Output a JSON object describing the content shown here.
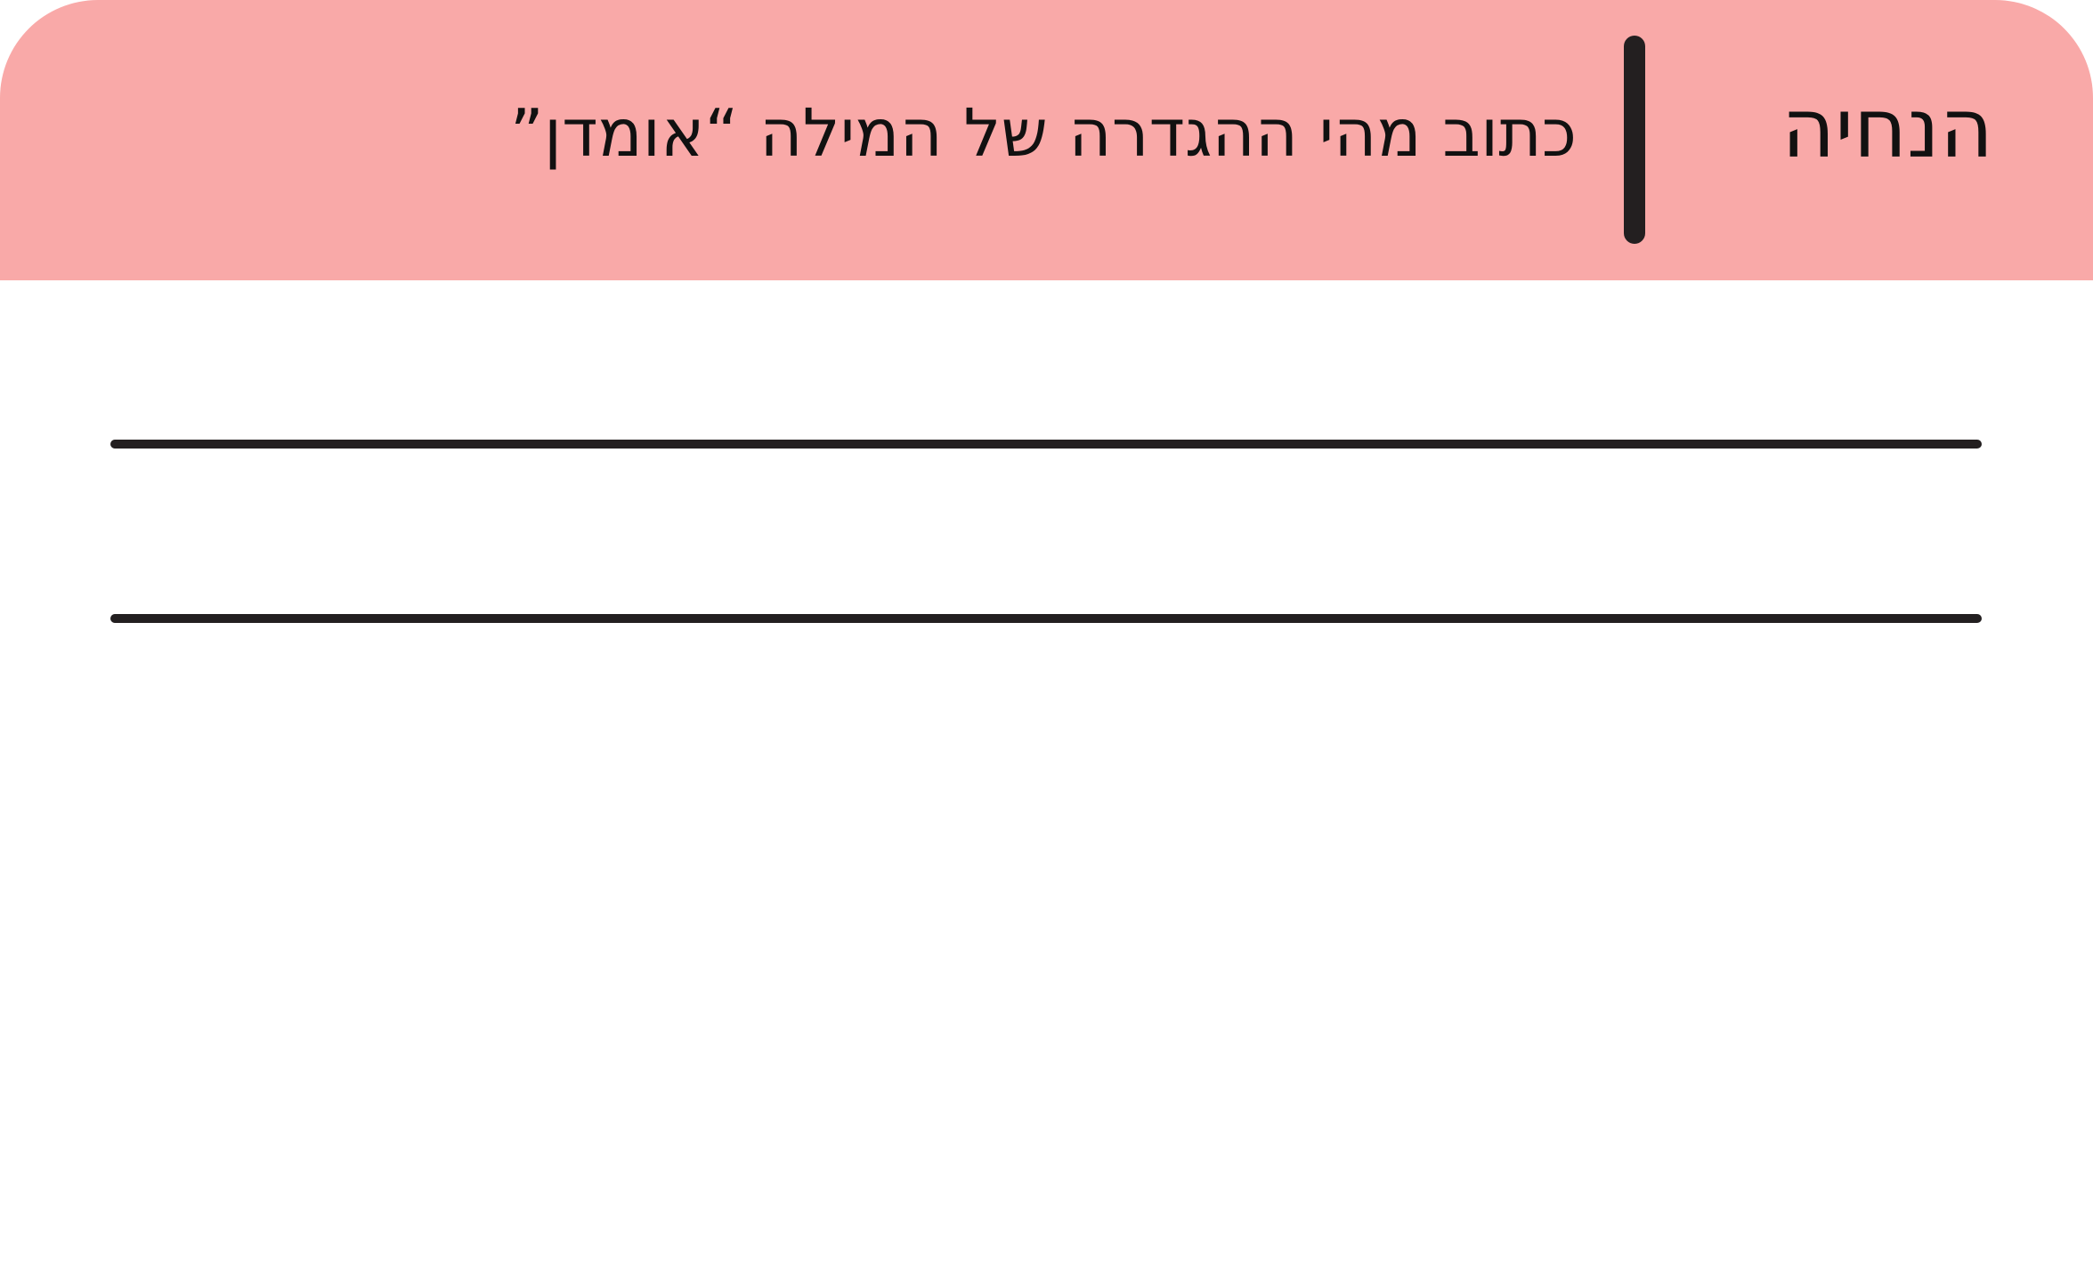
{
  "colors": {
    "header_bg": "#f9a9a8",
    "line": "#231f20",
    "page_bg": "#ffffff"
  },
  "header": {
    "title": "הנחיה",
    "instruction": "כתוב מהי ההגדרה של המילה “אומדן”"
  },
  "answer_lines": {
    "count": 2
  }
}
